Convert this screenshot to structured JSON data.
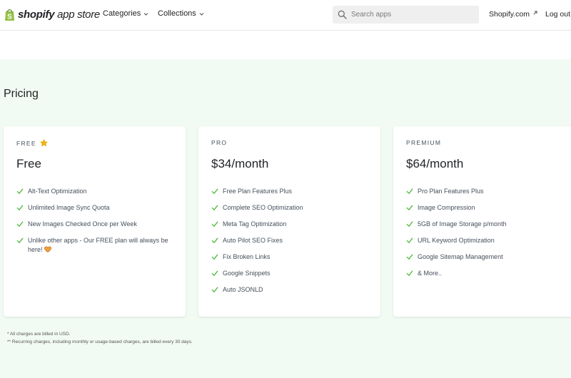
{
  "header": {
    "logo_strong": "shopify",
    "logo_light": " app store",
    "nav": {
      "categories": "Categories",
      "collections": "Collections"
    },
    "search_placeholder": "Search apps",
    "shopify_link": "Shopify.com",
    "logout": "Log out"
  },
  "pricing": {
    "title": "Pricing",
    "plans": [
      {
        "label": "FREE",
        "price": "Free",
        "features": [
          "Alt-Text Optimization",
          "Unlimited Image Sync Quota",
          "New Images Checked Once per Week",
          "Unlike other apps - Our FREE plan will always be here!"
        ]
      },
      {
        "label": "PRO",
        "price": "$34/month",
        "features": [
          "Free Plan Features Plus",
          "Complete SEO Optimization",
          "Meta Tag Optimization",
          "Auto Pilot SEO Fixes",
          "Fix Broken Links",
          "Google Snippets",
          "Auto JSONLD"
        ]
      },
      {
        "label": "PREMIUM",
        "price": "$64/month",
        "features": [
          "Pro Plan Features Plus",
          "Image Compression",
          "5GB of Image Storage p/month",
          "URL Keyword Optimization",
          "Google Sitemap Management",
          "& More.."
        ]
      }
    ],
    "footnotes": [
      "* All charges are billed in USD.",
      "** Recurring charges, including monthly or usage-based charges, are billed every 30 days."
    ]
  },
  "colors": {
    "brand_green": "#95bf47",
    "check_green": "#50b83c",
    "section_bg": "#f2fbf3",
    "star": "#f4b400",
    "heart": "#f2a03d"
  },
  "icons": {
    "logo": "shopping-bag-icon",
    "nav_chevron": "chevron-down-icon",
    "search": "search-icon",
    "external": "external-link-icon",
    "free_badge": "star-icon",
    "feature_bullet": "check-icon",
    "heart": "heart-icon"
  }
}
